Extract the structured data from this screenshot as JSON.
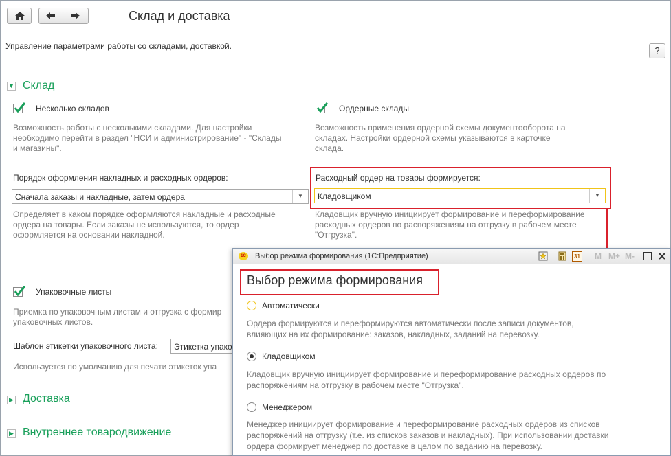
{
  "window": {
    "title": "Склад и доставка",
    "subtitle": "Управление параметрами работы со складами, доставкой.",
    "help_label": "?"
  },
  "sections": {
    "warehouse": "Склад",
    "delivery": "Доставка",
    "internal": "Внутреннее товародвижение"
  },
  "multi_warehouses": {
    "label": "Несколько складов",
    "checked": true,
    "hint_lines": [
      "Возможность работы с несколькими складами. Для настройки",
      "необходимо перейти в раздел \"НСИ и администрирование\" - \"Склады",
      "и магазины\"."
    ]
  },
  "order_warehouses": {
    "label": "Ордерные склады",
    "checked": true,
    "hint_lines": [
      "Возможность применения ордерной схемы документооборота на",
      "складах. Настройки ордерной схемы указываются в карточке",
      "склада."
    ]
  },
  "invoice_order": {
    "label": "Порядок оформления накладных и расходных ордеров:",
    "value": "Сначала заказы и накладные, затем ордера",
    "hint_lines": [
      "Определяет в каком порядке оформляются накладные и расходные",
      "ордера на товары. Если заказы не используются, то ордер",
      "оформляется на основании накладной."
    ]
  },
  "expense_order": {
    "label": "Расходный ордер на товары формируется:",
    "value": "Кладовщиком",
    "hint_lines": [
      "Кладовщик вручную инициирует формирование и переформирование",
      "расходных ордеров по распоряжениям на отгрузку в рабочем месте",
      "\"Отгрузка\"."
    ]
  },
  "packing_lists": {
    "label": "Упаковочные листы",
    "checked": true,
    "hint_lines": [
      "Приемка по упаковочным листам и отгрузка с формир",
      "упаковочных листов."
    ],
    "template_label": "Шаблон этикетки упаковочного листа:",
    "template_value": "Этикетка упаков",
    "template_hint": "Используется по умолчанию для печати этикеток упа"
  },
  "dialog": {
    "window_title": "Выбор режима формирования  (1С:Предприятие)",
    "logo_text": "1С",
    "heading": "Выбор режима формирования",
    "options": [
      {
        "label": "Автоматически",
        "selected": false,
        "hint_lines": [
          "Ордера формируются и переформируются автоматически после записи документов,",
          "влияющих на их формирование: заказов, накладных, заданий на перевозку."
        ]
      },
      {
        "label": "Кладовщиком",
        "selected": true,
        "hint_lines": [
          "Кладовщик вручную инициирует формирование и переформирование расходных ордеров по",
          "распоряжениям на отгрузку в рабочем месте \"Отгрузка\"."
        ]
      },
      {
        "label": "Менеджером",
        "selected": false,
        "hint_lines": [
          "Менеджер инициирует формирование и переформирование расходных ордеров из списков",
          "распоряжений на отгрузку (т.е. из списков заказов и накладных). При использовании доставки",
          "ордера формирует менеджер по доставке в целом по заданию на перевозку."
        ]
      }
    ],
    "toolbar_icons": [
      "favorite-icon",
      "calculator-icon",
      "calendar-icon"
    ],
    "calendar_label": "31",
    "memory_labels": [
      "M",
      "M+",
      "M-"
    ]
  },
  "colors": {
    "accent_green": "#1aa05b",
    "highlight_red": "#d9212c",
    "hint_gray": "#7a7a7a",
    "focus_yellow": "#f0c419"
  }
}
